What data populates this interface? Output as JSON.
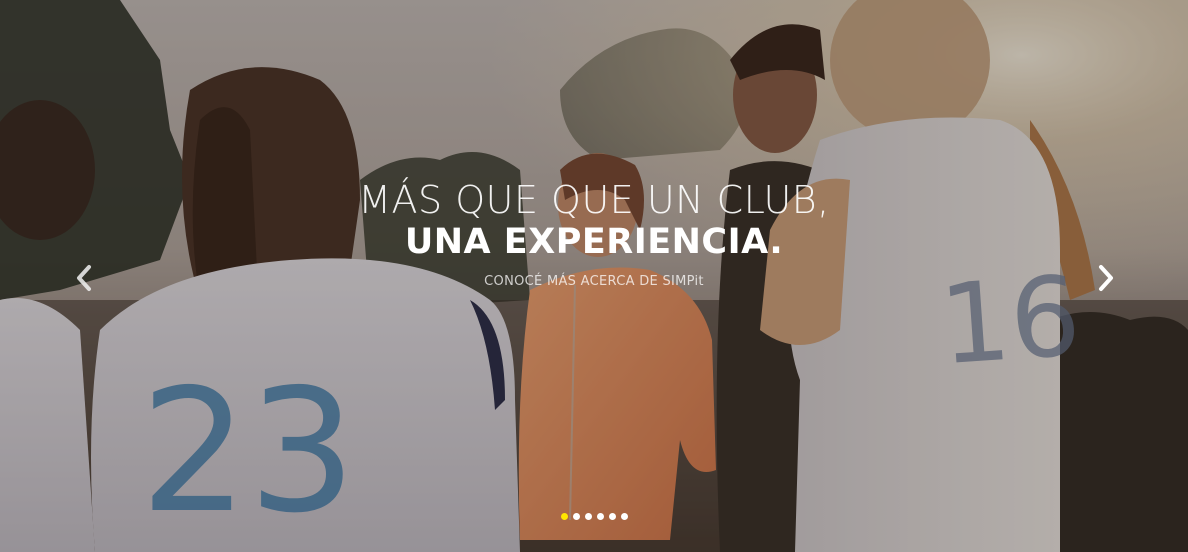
{
  "slider": {
    "title_line1": "MÁS QUE QUE UN CLUB,",
    "title_line2": "UNA EXPERIENCIA.",
    "subtitle": "CONOCÉ MÁS ACERCA DE SIMPit",
    "prev_icon": "chevron-left-icon",
    "next_icon": "chevron-right-icon",
    "slide_count": 6,
    "active_slide": 1,
    "active_dot_color": "#ffe600",
    "jersey_numbers": [
      "23",
      "16"
    ]
  }
}
